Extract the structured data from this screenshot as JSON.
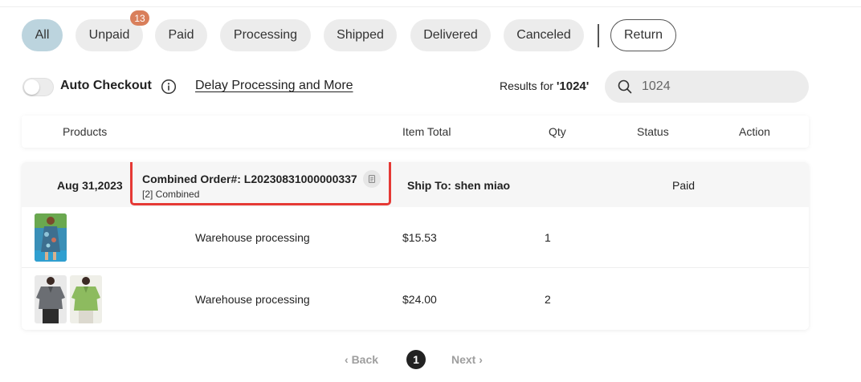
{
  "tabs": [
    {
      "label": "All",
      "active": true
    },
    {
      "label": "Unpaid",
      "badge": "13"
    },
    {
      "label": "Paid"
    },
    {
      "label": "Processing"
    },
    {
      "label": "Shipped"
    },
    {
      "label": "Delivered"
    },
    {
      "label": "Canceled"
    },
    {
      "label": "Return"
    }
  ],
  "toolbar": {
    "auto_checkout_label": "Auto Checkout",
    "auto_checkout_on": false,
    "delay_link": "Delay Processing and More",
    "results_prefix": "Results for ",
    "results_query": "'1024'"
  },
  "search": {
    "value": "1024",
    "icon": "search-icon"
  },
  "table_headers": [
    "Products",
    "Item Total",
    "Qty",
    "Status",
    "Action"
  ],
  "order": {
    "date": "Aug 31,2023",
    "order_number": "Combined Order#: L20230831000000337",
    "combined_note": "[2] Combined",
    "ship_to": "Ship To: shen miao",
    "status": "Paid",
    "items": [
      {
        "state": "Warehouse processing",
        "total": "$15.53",
        "qty": "1",
        "thumbs": [
          "floral-dress"
        ]
      },
      {
        "state": "Warehouse processing",
        "total": "$24.00",
        "qty": "2",
        "thumbs": [
          "gray-polo",
          "green-polo"
        ]
      }
    ]
  },
  "pagination": {
    "prev": "Back",
    "current": "1",
    "next": "Next"
  },
  "colors": {
    "active_tab": "#bcd4de",
    "badge": "#d97f5b",
    "highlight": "#e53935"
  }
}
